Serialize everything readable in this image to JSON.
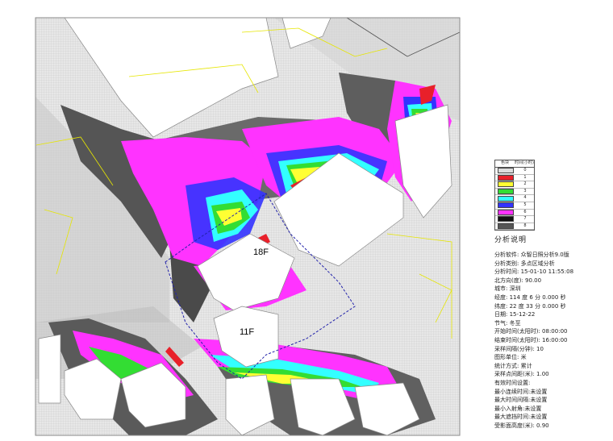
{
  "labels": {
    "building_a": "18F",
    "building_b": "11F"
  },
  "legend": {
    "header": [
      "色块",
      "时间(小时)"
    ],
    "rows": [
      {
        "value": "0",
        "color": "#dcdcdc"
      },
      {
        "value": "1",
        "color": "#e8202a"
      },
      {
        "value": "2",
        "color": "#ffff33"
      },
      {
        "value": "3",
        "color": "#33dd33"
      },
      {
        "value": "4",
        "color": "#33ffff"
      },
      {
        "value": "5",
        "color": "#3333ff"
      },
      {
        "value": "6",
        "color": "#ff33ff"
      },
      {
        "value": "7",
        "color": "#111111"
      },
      {
        "value": "8",
        "color": "#555555"
      }
    ]
  },
  "notes": {
    "title": "分析说明",
    "lines": [
      "分析软件: 众智日照分析9.0版",
      "分析类别: 多点区域分析",
      "分析时间: 15-01-10 11:55:08",
      "北方向(度): 90.00",
      "城市: 深圳",
      "经度: 114 度 6 分 0.000 秒",
      "纬度: 22 度 33 分 0.000 秒",
      "日期: 15-12-22",
      "节气: 冬至",
      "开始时间(太阳时): 08:00:00",
      "结束时间(太阳时): 16:00:00",
      "采样间隔(分钟): 10",
      "图形单位: 米",
      "统计方式: 累计",
      "采样点间距(米): 1.00",
      "有效时间设置:",
      "最小连续时间:未设置",
      "最大时间间隔:未设置",
      "最小入射角:未设置",
      "最大遮挡时间:未设置",
      "受影面高度(米): 0.90"
    ]
  }
}
